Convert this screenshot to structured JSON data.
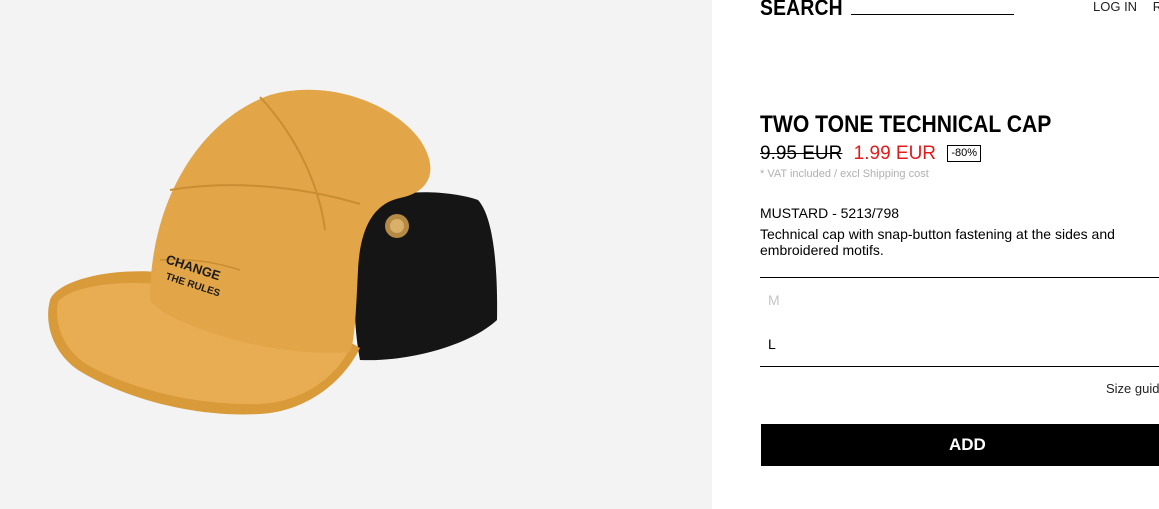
{
  "header": {
    "search_label": "SEARCH",
    "search_value": "",
    "login_label": "LOG IN",
    "next_link_label": "R"
  },
  "product": {
    "image_icon": "technical-cap-photo",
    "image_text_line1": "CHANGE",
    "image_text_line2": "THE RULES",
    "title": "TWO TONE TECHNICAL CAP",
    "old_price": "9.95 EUR",
    "new_price": "1.99 EUR",
    "discount": "-80%",
    "vat_note": "* VAT included / excl Shipping cost",
    "color_ref": "MUSTARD - 5213/798",
    "description": "Technical cap with snap-button fastening at the sides and embroidered motifs.",
    "sizes": [
      {
        "label": "M",
        "available": false
      },
      {
        "label": "L",
        "available": true
      }
    ],
    "size_guide_label": "Size guide",
    "add_label": "ADD"
  },
  "colors": {
    "price_sale": "#e31b1b",
    "cap_mustard": "#e2a649",
    "ear_flap": "#111111",
    "image_background": "#f3f3f3"
  }
}
